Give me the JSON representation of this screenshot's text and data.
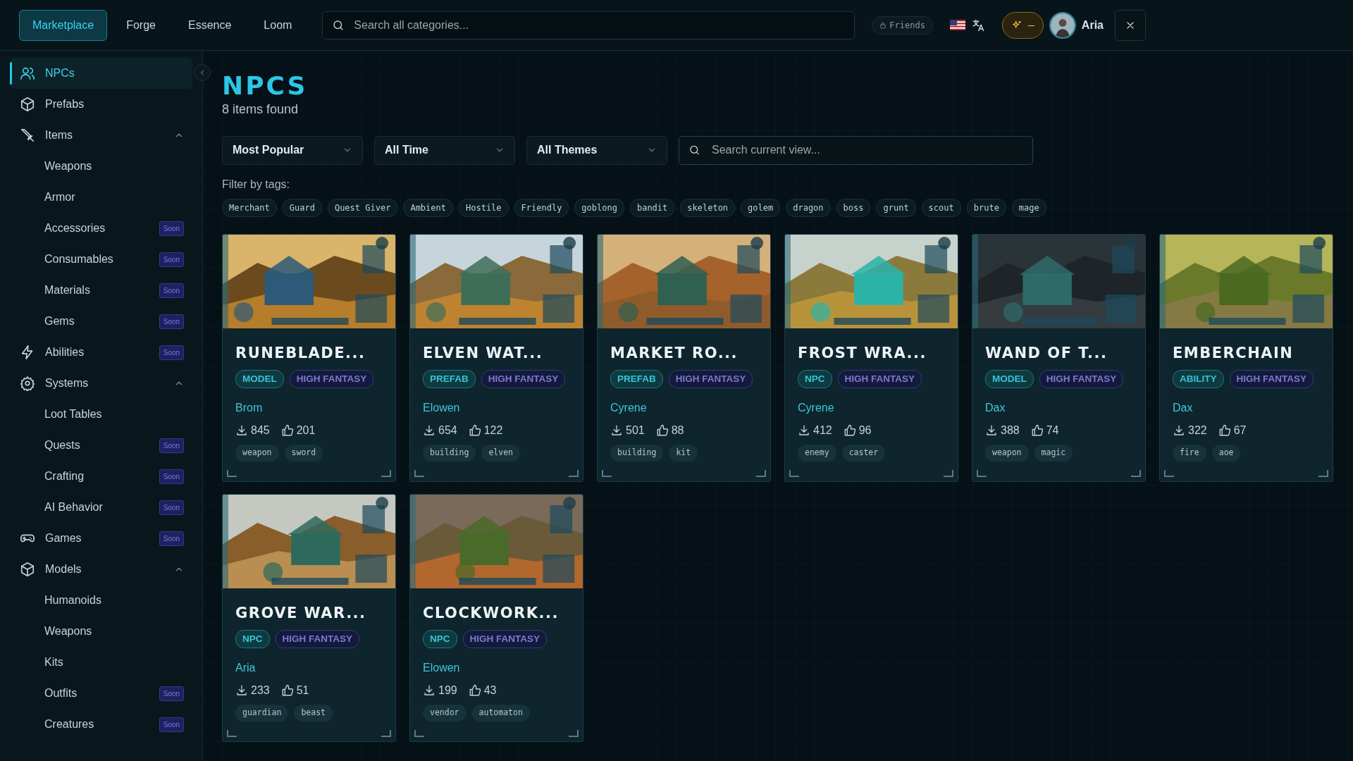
{
  "nav": {
    "tabs": [
      {
        "label": "Marketplace",
        "selected": true
      },
      {
        "label": "Forge",
        "selected": false
      },
      {
        "label": "Essence",
        "selected": false
      },
      {
        "label": "Loom",
        "selected": false
      }
    ]
  },
  "search": {
    "placeholder": "Search all categories..."
  },
  "friends_button": "Friends",
  "credits_button": "–",
  "user": {
    "name": "Aria"
  },
  "sidebar": {
    "items": [
      {
        "label": "NPCs",
        "selected": true
      },
      {
        "label": "Prefabs",
        "selected": false
      },
      {
        "label": "Items",
        "selected": false,
        "expanded": true,
        "children": [
          {
            "label": "Weapons",
            "selected": false
          },
          {
            "label": "Armor",
            "selected": false
          },
          {
            "label": "Accessories",
            "selected": false,
            "badge": "Soon"
          },
          {
            "label": "Consumables",
            "selected": false,
            "badge": "Soon"
          },
          {
            "label": "Materials",
            "selected": false,
            "badge": "Soon"
          },
          {
            "label": "Gems",
            "selected": false,
            "badge": "Soon"
          }
        ]
      },
      {
        "label": "Abilities",
        "selected": false,
        "badge": "Soon"
      },
      {
        "label": "Systems",
        "selected": false,
        "expanded": true,
        "children": [
          {
            "label": "Loot Tables",
            "selected": false
          },
          {
            "label": "Quests",
            "selected": false,
            "badge": "Soon"
          },
          {
            "label": "Crafting",
            "selected": false,
            "badge": "Soon"
          },
          {
            "label": "AI Behavior",
            "selected": false,
            "badge": "Soon"
          }
        ]
      },
      {
        "label": "Games",
        "selected": false,
        "badge": "Soon"
      },
      {
        "label": "Models",
        "selected": false,
        "expanded": true,
        "children": [
          {
            "label": "Humanoids",
            "selected": false
          },
          {
            "label": "Weapons",
            "selected": false
          },
          {
            "label": "Kits",
            "selected": false
          },
          {
            "label": "Outfits",
            "selected": false,
            "badge": "Soon"
          },
          {
            "label": "Creatures",
            "selected": false,
            "badge": "Soon"
          }
        ]
      }
    ]
  },
  "page": {
    "title": "NPCS",
    "count": "8 items found"
  },
  "filters": {
    "dropdowns": [
      {
        "value": "Most Popular"
      },
      {
        "value": "All Time"
      },
      {
        "value": "All Themes"
      }
    ],
    "search": {
      "placeholder": "Search current view..."
    },
    "tags_label": "Filter by tags:",
    "tags": [
      "Merchant",
      "Guard",
      "Quest Giver",
      "Ambient",
      "Hostile",
      "Friendly",
      "goblong",
      "bandit",
      "skeleton",
      "golem",
      "dragon",
      "boss",
      "grunt",
      "scout",
      "brute",
      "mage"
    ]
  },
  "cards": [
    {
      "title": "RUNEBLADE...",
      "type": "MODEL",
      "theme": "HIGH FANTASY",
      "author": "Brom",
      "downloads": "845",
      "likes": "201",
      "tags": [
        "weapon",
        "sword"
      ]
    },
    {
      "title": "ELVEN WAT...",
      "type": "PREFAB",
      "theme": "HIGH FANTASY",
      "author": "Elowen",
      "downloads": "654",
      "likes": "122",
      "tags": [
        "building",
        "elven"
      ]
    },
    {
      "title": "MARKET RO...",
      "type": "PREFAB",
      "theme": "HIGH FANTASY",
      "author": "Cyrene",
      "downloads": "501",
      "likes": "88",
      "tags": [
        "building",
        "kit"
      ]
    },
    {
      "title": "FROST WRA...",
      "type": "NPC",
      "theme": "HIGH FANTASY",
      "author": "Cyrene",
      "downloads": "412",
      "likes": "96",
      "tags": [
        "enemy",
        "caster"
      ]
    },
    {
      "title": "WAND OF T...",
      "type": "MODEL",
      "theme": "HIGH FANTASY",
      "author": "Dax",
      "downloads": "388",
      "likes": "74",
      "tags": [
        "weapon",
        "magic"
      ]
    },
    {
      "title": "EMBERCHAIN",
      "type": "ABILITY",
      "theme": "HIGH FANTASY",
      "author": "Dax",
      "downloads": "322",
      "likes": "67",
      "tags": [
        "fire",
        "aoe"
      ]
    },
    {
      "title": "GROVE WAR...",
      "type": "NPC",
      "theme": "HIGH FANTASY",
      "author": "Aria",
      "downloads": "233",
      "likes": "51",
      "tags": [
        "guardian",
        "beast"
      ]
    },
    {
      "title": "CLOCKWORK...",
      "type": "NPC",
      "theme": "HIGH FANTASY",
      "author": "Elowen",
      "downloads": "199",
      "likes": "43",
      "tags": [
        "vendor",
        "automaton"
      ]
    }
  ]
}
